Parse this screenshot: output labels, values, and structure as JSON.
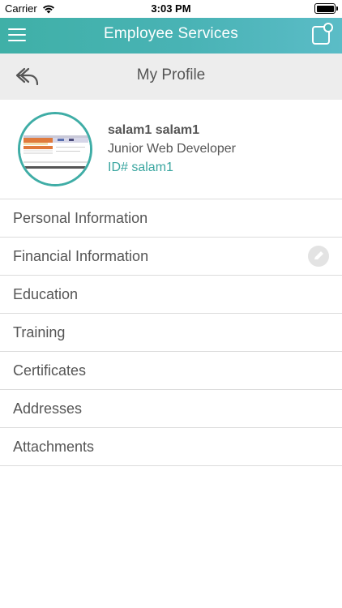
{
  "status_bar": {
    "carrier": "Carrier",
    "time": "3:03 PM"
  },
  "app_bar": {
    "title": "Employee Services",
    "menu_icon": "hamburger-menu-icon",
    "notify_icon": "notification-square-icon"
  },
  "sub_header": {
    "title": "My Profile",
    "back_icon": "back-arrow-icon"
  },
  "profile": {
    "name": "salam1 salam1",
    "role": "Junior Web Developer",
    "id_label": "ID# salam1"
  },
  "menu": {
    "items": [
      {
        "label": "Personal Information"
      },
      {
        "label": "Financial Information"
      },
      {
        "label": "Education"
      },
      {
        "label": "Training"
      },
      {
        "label": "Certificates"
      },
      {
        "label": "Addresses"
      },
      {
        "label": "Attachments"
      }
    ]
  },
  "colors": {
    "accent": "#3fb0a7",
    "id_text": "#3aa6a0",
    "text": "#555555",
    "subheader_bg": "#ededed"
  }
}
